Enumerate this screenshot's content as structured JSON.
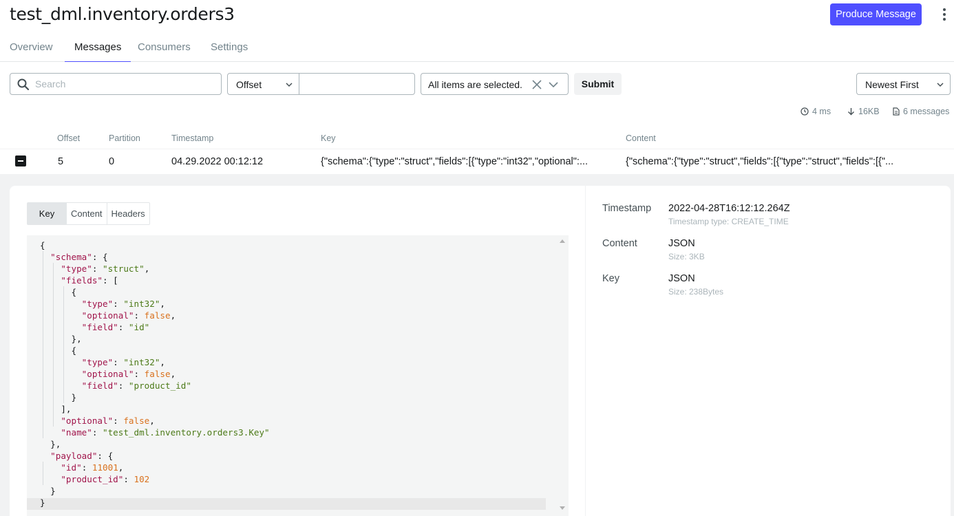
{
  "header": {
    "title": "test_dml.inventory.orders3",
    "produce_label": "Produce Message"
  },
  "tabs": [
    {
      "label": "Overview"
    },
    {
      "label": "Messages"
    },
    {
      "label": "Consumers"
    },
    {
      "label": "Settings"
    }
  ],
  "filters": {
    "search_placeholder": "Search",
    "seek_type": "Offset",
    "seek_value": "",
    "partitions": "All items are selected.",
    "submit_label": "Submit",
    "sort": "Newest First"
  },
  "stats": {
    "elapsed": "4 ms",
    "bytes": "16KB",
    "messages": "6 messages"
  },
  "table": {
    "columns": [
      "Offset",
      "Partition",
      "Timestamp",
      "Key",
      "Content"
    ],
    "rows": [
      {
        "offset": "5",
        "partition": "0",
        "timestamp": "04.29.2022 00:12:12",
        "key": "{\"schema\":{\"type\":\"struct\",\"fields\":[{\"type\":\"int32\",\"optional\":...",
        "content": "{\"schema\":{\"type\":\"struct\",\"fields\":[{\"type\":\"struct\",\"fields\":[{\"..."
      }
    ]
  },
  "detail": {
    "subtabs": [
      "Key",
      "Content",
      "Headers"
    ],
    "active_subtab": "Key",
    "meta": {
      "timestamp_label": "Timestamp",
      "timestamp_value": "2022-04-28T16:12:12.264Z",
      "timestamp_type": "Timestamp type: CREATE_TIME",
      "content_label": "Content",
      "content_value": "JSON",
      "content_size": "Size: 3KB",
      "key_label": "Key",
      "key_value": "JSON",
      "key_size": "Size: 238Bytes"
    },
    "code_lines": [
      [
        [
          "p",
          "{"
        ]
      ],
      [
        [
          "p",
          "  "
        ],
        [
          "k",
          "\"schema\""
        ],
        [
          "p",
          ": {"
        ]
      ],
      [
        [
          "p",
          "    "
        ],
        [
          "k",
          "\"type\""
        ],
        [
          "p",
          ": "
        ],
        [
          "s",
          "\"struct\""
        ],
        [
          "p",
          ","
        ]
      ],
      [
        [
          "p",
          "    "
        ],
        [
          "k",
          "\"fields\""
        ],
        [
          "p",
          ": ["
        ]
      ],
      [
        [
          "p",
          "      {"
        ]
      ],
      [
        [
          "p",
          "        "
        ],
        [
          "k",
          "\"type\""
        ],
        [
          "p",
          ": "
        ],
        [
          "s",
          "\"int32\""
        ],
        [
          "p",
          ","
        ]
      ],
      [
        [
          "p",
          "        "
        ],
        [
          "k",
          "\"optional\""
        ],
        [
          "p",
          ": "
        ],
        [
          "n",
          "false"
        ],
        [
          "p",
          ","
        ]
      ],
      [
        [
          "p",
          "        "
        ],
        [
          "k",
          "\"field\""
        ],
        [
          "p",
          ": "
        ],
        [
          "s",
          "\"id\""
        ]
      ],
      [
        [
          "p",
          "      },"
        ]
      ],
      [
        [
          "p",
          "      {"
        ]
      ],
      [
        [
          "p",
          "        "
        ],
        [
          "k",
          "\"type\""
        ],
        [
          "p",
          ": "
        ],
        [
          "s",
          "\"int32\""
        ],
        [
          "p",
          ","
        ]
      ],
      [
        [
          "p",
          "        "
        ],
        [
          "k",
          "\"optional\""
        ],
        [
          "p",
          ": "
        ],
        [
          "n",
          "false"
        ],
        [
          "p",
          ","
        ]
      ],
      [
        [
          "p",
          "        "
        ],
        [
          "k",
          "\"field\""
        ],
        [
          "p",
          ": "
        ],
        [
          "s",
          "\"product_id\""
        ]
      ],
      [
        [
          "p",
          "      }"
        ]
      ],
      [
        [
          "p",
          "    ],"
        ]
      ],
      [
        [
          "p",
          "    "
        ],
        [
          "k",
          "\"optional\""
        ],
        [
          "p",
          ": "
        ],
        [
          "n",
          "false"
        ],
        [
          "p",
          ","
        ]
      ],
      [
        [
          "p",
          "    "
        ],
        [
          "k",
          "\"name\""
        ],
        [
          "p",
          ": "
        ],
        [
          "s",
          "\"test_dml.inventory.orders3.Key\""
        ]
      ],
      [
        [
          "p",
          "  },"
        ]
      ],
      [
        [
          "p",
          "  "
        ],
        [
          "k",
          "\"payload\""
        ],
        [
          "p",
          ": {"
        ]
      ],
      [
        [
          "p",
          "    "
        ],
        [
          "k",
          "\"id\""
        ],
        [
          "p",
          ": "
        ],
        [
          "n",
          "11001"
        ],
        [
          "p",
          ","
        ]
      ],
      [
        [
          "p",
          "    "
        ],
        [
          "k",
          "\"product_id\""
        ],
        [
          "p",
          ": "
        ],
        [
          "n",
          "102"
        ]
      ],
      [
        [
          "p",
          "  }"
        ]
      ],
      [
        [
          "p",
          "}"
        ]
      ]
    ]
  },
  "colors": {
    "accent": "#4f4fff",
    "json_key": "#a1154b",
    "json_string": "#4c7a18",
    "json_literal": "#d9711d"
  }
}
